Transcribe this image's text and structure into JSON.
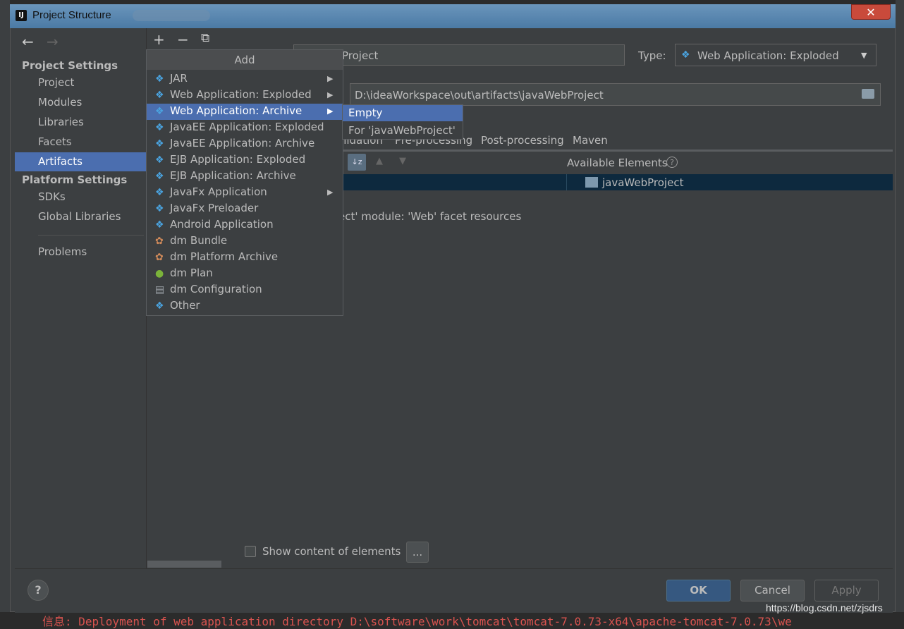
{
  "window": {
    "title": "Project Structure",
    "close_icon": "close-icon"
  },
  "sidebar": {
    "project_settings_heading": "Project Settings",
    "project_items": [
      "Project",
      "Modules",
      "Libraries",
      "Facets",
      "Artifacts"
    ],
    "selected_item": "Artifacts",
    "platform_settings_heading": "Platform Settings",
    "platform_items": [
      "SDKs",
      "Global Libraries"
    ],
    "problems": "Problems"
  },
  "toolbar": {
    "add": "+",
    "remove": "−",
    "copy": "⧉"
  },
  "artifact": {
    "name_value": "Project",
    "type_label": "Type:",
    "type_value": "Web Application: Exploded",
    "output_dir": "D:\\ideaWorkspace\\out\\artifacts\\javaWebProject",
    "tabs": [
      "alidation",
      "Pre-processing",
      "Post-processing",
      "Maven"
    ],
    "available_elements_label": "Available Elements",
    "module_name": "javaWebProject",
    "facet_resources": "ect' module: 'Web' facet resources",
    "show_content_label": "Show content of elements",
    "dots_button": "..."
  },
  "add_menu": {
    "title": "Add",
    "items": [
      {
        "label": "JAR",
        "icon": "jar-icon",
        "submenu": true
      },
      {
        "label": "Web Application: Exploded",
        "icon": "web-exploded-icon",
        "submenu": true
      },
      {
        "label": "Web Application: Archive",
        "icon": "web-archive-icon",
        "submenu": true,
        "selected": true
      },
      {
        "label": "JavaEE Application: Exploded",
        "icon": "javaee-exploded-icon"
      },
      {
        "label": "JavaEE Application: Archive",
        "icon": "javaee-archive-icon"
      },
      {
        "label": "EJB Application: Exploded",
        "icon": "ejb-exploded-icon"
      },
      {
        "label": "EJB Application: Archive",
        "icon": "ejb-archive-icon"
      },
      {
        "label": "JavaFx Application",
        "icon": "javafx-icon",
        "submenu": true
      },
      {
        "label": "JavaFx Preloader",
        "icon": "javafx-preloader-icon"
      },
      {
        "label": "Android Application",
        "icon": "android-icon"
      },
      {
        "label": "dm Bundle",
        "icon": "dm-bundle-icon"
      },
      {
        "label": "dm Platform Archive",
        "icon": "dm-platform-icon"
      },
      {
        "label": "dm Plan",
        "icon": "dm-plan-icon"
      },
      {
        "label": "dm Configuration",
        "icon": "dm-config-icon"
      },
      {
        "label": "Other",
        "icon": "other-icon"
      }
    ],
    "submenu_items": [
      "Empty",
      "For 'javaWebProject'"
    ]
  },
  "footer": {
    "help": "?",
    "ok": "OK",
    "cancel": "Cancel",
    "apply": "Apply"
  },
  "background": {
    "console_line": "信息: Deployment of web application directory D:\\software\\work\\tomcat\\tomcat-7.0.73-x64\\apache-tomcat-7.0.73\\we",
    "watermark": "https://blog.csdn.net/zjsdrs"
  },
  "colors": {
    "selection": "#4b6eaf",
    "ok_button": "#365880",
    "title_bar": "#4b7aa5",
    "close_button": "#c94a3b"
  }
}
